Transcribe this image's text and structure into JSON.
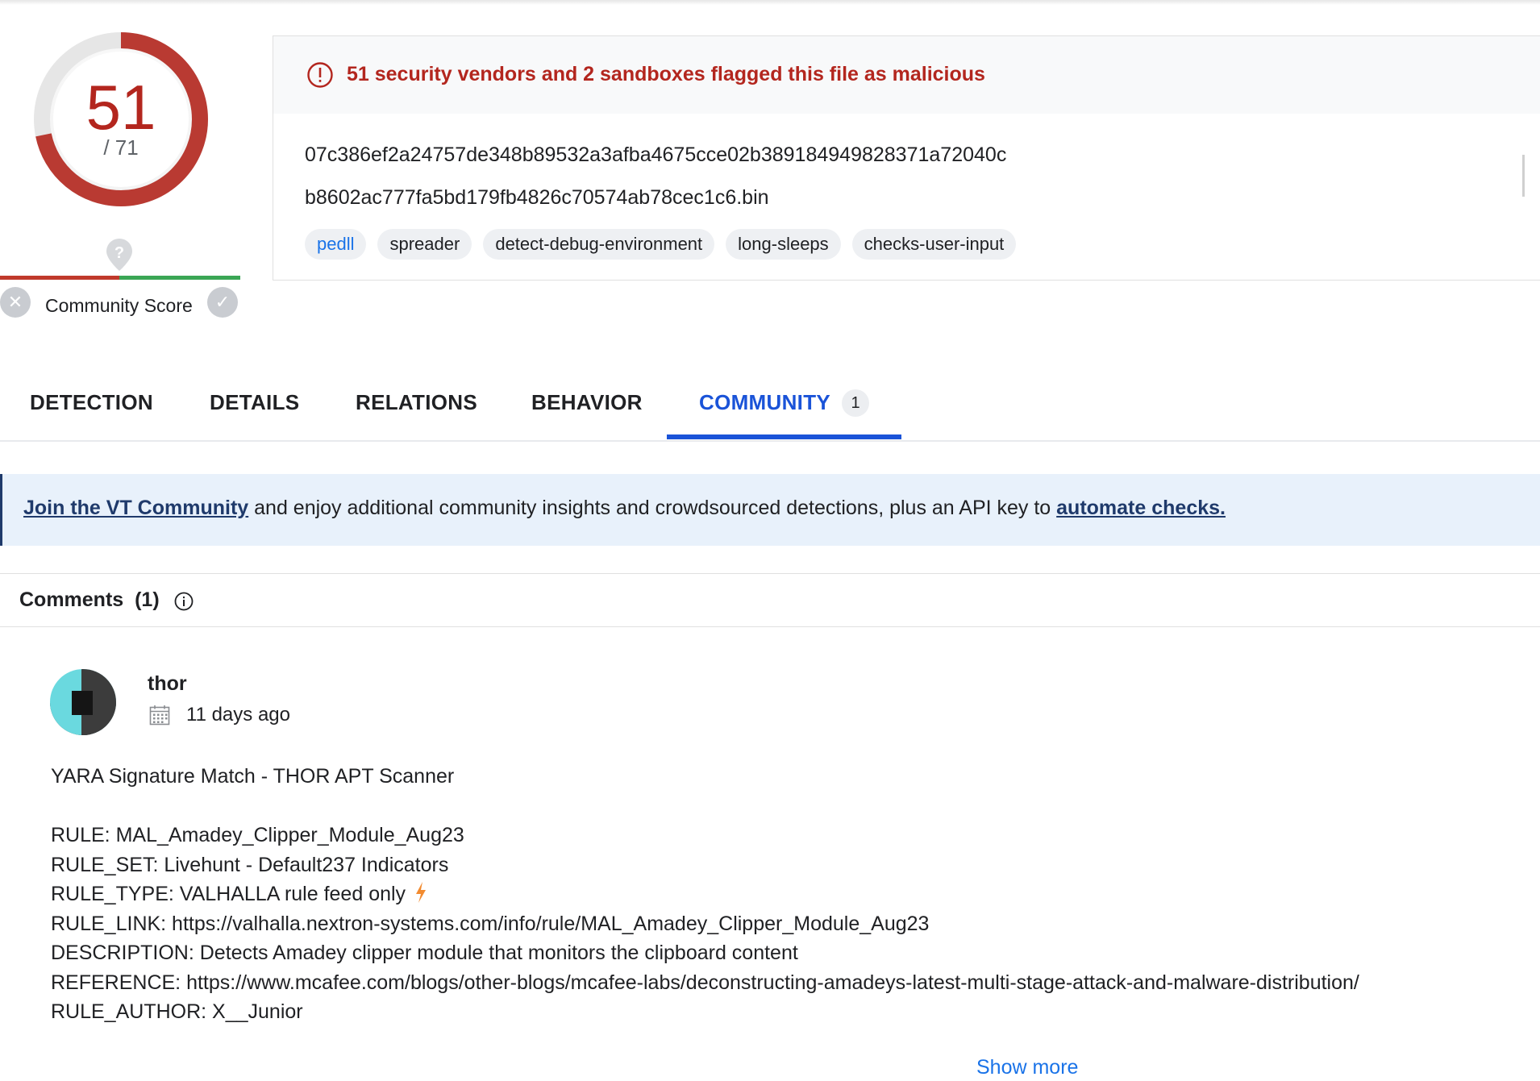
{
  "score": {
    "detected": "51",
    "total": "/ 71",
    "detected_fraction": 0.718
  },
  "community_score": {
    "label": "Community Score",
    "question_icon": "question-icon",
    "down_icon": "x-icon",
    "up_icon": "check-icon"
  },
  "alert": {
    "text": "51 security vendors and 2 sandboxes flagged this file as malicious",
    "icon": "alert-circle-icon"
  },
  "file": {
    "hash": "07c386ef2a24757de348b89532a3afba4675cce02b389184949828371a72040c",
    "name": "b8602ac777fa5bd179fb4826c70574ab78cec1c6.bin"
  },
  "tags": [
    "pedll",
    "spreader",
    "detect-debug-environment",
    "long-sleeps",
    "checks-user-input"
  ],
  "tabs": [
    {
      "label": "DETECTION"
    },
    {
      "label": "DETAILS"
    },
    {
      "label": "RELATIONS"
    },
    {
      "label": "BEHAVIOR"
    },
    {
      "label": "COMMUNITY",
      "badge": "1",
      "active": true
    }
  ],
  "banner": {
    "link1": "Join the VT Community",
    "middle": " and enjoy additional community insights and crowdsourced detections, plus an API key to ",
    "link2": "automate checks."
  },
  "comments": {
    "header": "Comments",
    "count": "(1)",
    "item": {
      "author": "thor",
      "date": "11 days ago",
      "lines": [
        "YARA Signature Match - THOR APT Scanner",
        "",
        "RULE: MAL_Amadey_Clipper_Module_Aug23",
        "RULE_SET: Livehunt - Default237 Indicators",
        "RULE_TYPE: VALHALLA rule feed only",
        "RULE_LINK: https://valhalla.nextron-systems.com/info/rule/MAL_Amadey_Clipper_Module_Aug23",
        "DESCRIPTION: Detects Amadey clipper module that monitors the clipboard content",
        "REFERENCE: https://www.mcafee.com/blogs/other-blogs/mcafee-labs/deconstructing-amadeys-latest-multi-stage-attack-and-malware-distribution/",
        "RULE_AUTHOR: X__Junior"
      ]
    },
    "show_more": "Show more"
  },
  "colors": {
    "malicious": "#b3261e",
    "accent": "#1a53d8",
    "link": "#1a73e8",
    "banner_bg": "#e8f1fb"
  }
}
